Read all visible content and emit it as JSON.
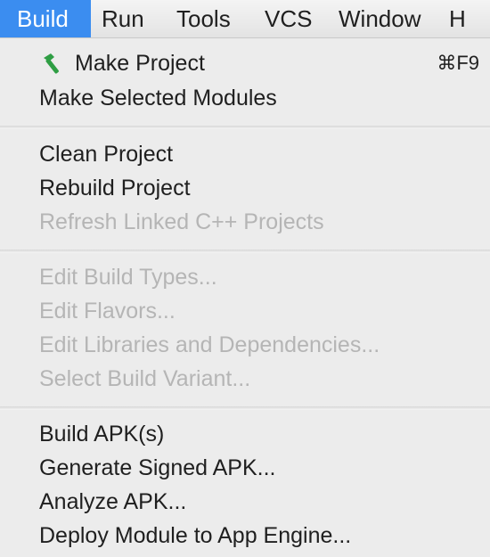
{
  "menubar": {
    "items": [
      {
        "label": "Build",
        "active": true
      },
      {
        "label": "Run",
        "active": false
      },
      {
        "label": "Tools",
        "active": false
      },
      {
        "label": "VCS",
        "active": false
      },
      {
        "label": "Window",
        "active": false
      },
      {
        "label": "H",
        "active": false
      }
    ]
  },
  "menu": {
    "items": [
      {
        "label": "Make Project",
        "shortcut": "⌘F9",
        "enabled": true,
        "icon": "hammer-icon"
      },
      {
        "label": "Make Selected Modules",
        "enabled": true
      },
      {
        "label": "Clean Project",
        "enabled": true
      },
      {
        "label": "Rebuild Project",
        "enabled": true
      },
      {
        "label": "Refresh Linked C++ Projects",
        "enabled": false
      },
      {
        "label": "Edit Build Types...",
        "enabled": false
      },
      {
        "label": "Edit Flavors...",
        "enabled": false
      },
      {
        "label": "Edit Libraries and Dependencies...",
        "enabled": false
      },
      {
        "label": "Select Build Variant...",
        "enabled": false
      },
      {
        "label": "Build APK(s)",
        "enabled": true
      },
      {
        "label": "Generate Signed APK...",
        "enabled": true
      },
      {
        "label": "Analyze APK...",
        "enabled": true
      },
      {
        "label": "Deploy Module to App Engine...",
        "enabled": true
      }
    ]
  },
  "colors": {
    "active_menu": "#3b8df0",
    "text": "#1f1f1f",
    "disabled_text": "#b5b5b5",
    "menu_background": "#ececec",
    "hammer_icon": "#2f9e44"
  }
}
